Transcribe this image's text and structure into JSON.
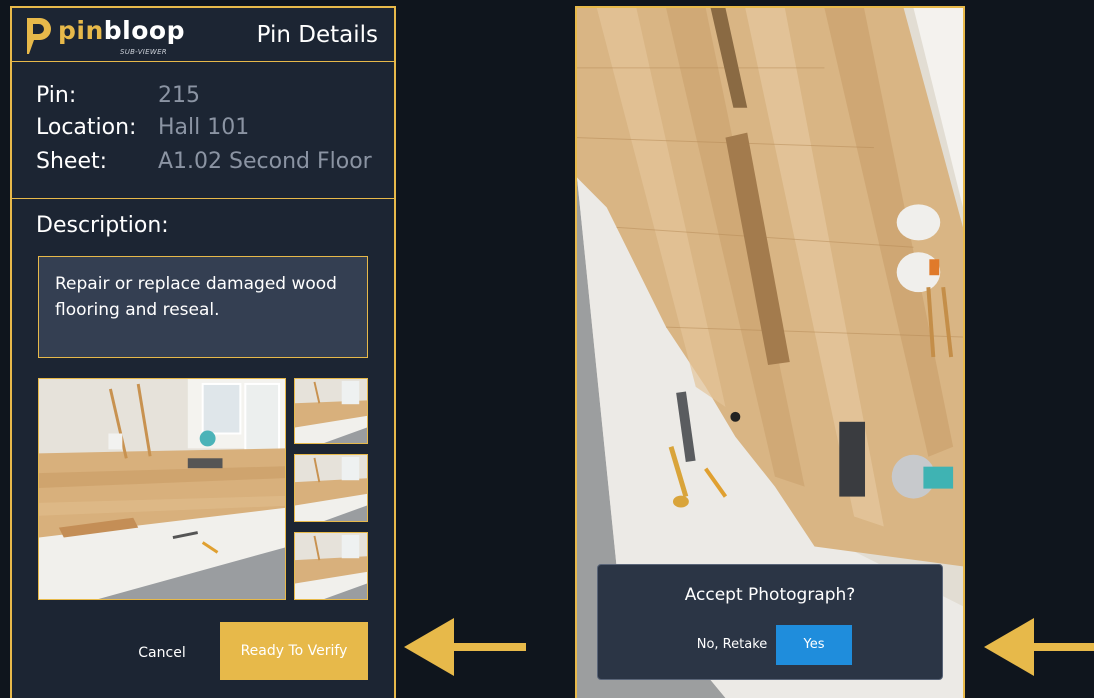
{
  "left_panel": {
    "brand": {
      "word_part1": "pin",
      "word_part2": "bloop",
      "subtitle": "SUB-VIEWER"
    },
    "header_title": "Pin Details",
    "info": {
      "pin_label": "Pin:",
      "pin_value": "215",
      "location_label": "Location:",
      "location_value": "Hall 101",
      "sheet_label": "Sheet:",
      "sheet_value": "A1.02 Second Floor"
    },
    "description_label": "Description:",
    "description_text": "Repair or replace damaged wood flooring and reseal.",
    "photos_count": 4,
    "cancel_label": "Cancel",
    "ready_label": "Ready To Verify"
  },
  "right_panel": {
    "dialog_title": "Accept Photograph?",
    "retake_label": "No, Retake",
    "yes_label": "Yes"
  },
  "colors": {
    "accent": "#e7b94a",
    "panel_bg": "#1c2533",
    "page_bg": "#0f151d",
    "primary_button": "#1f8ddc",
    "muted_text": "#8b94a3"
  },
  "icons": [
    "pinbloop-logo-icon",
    "arrow-left-icon"
  ]
}
